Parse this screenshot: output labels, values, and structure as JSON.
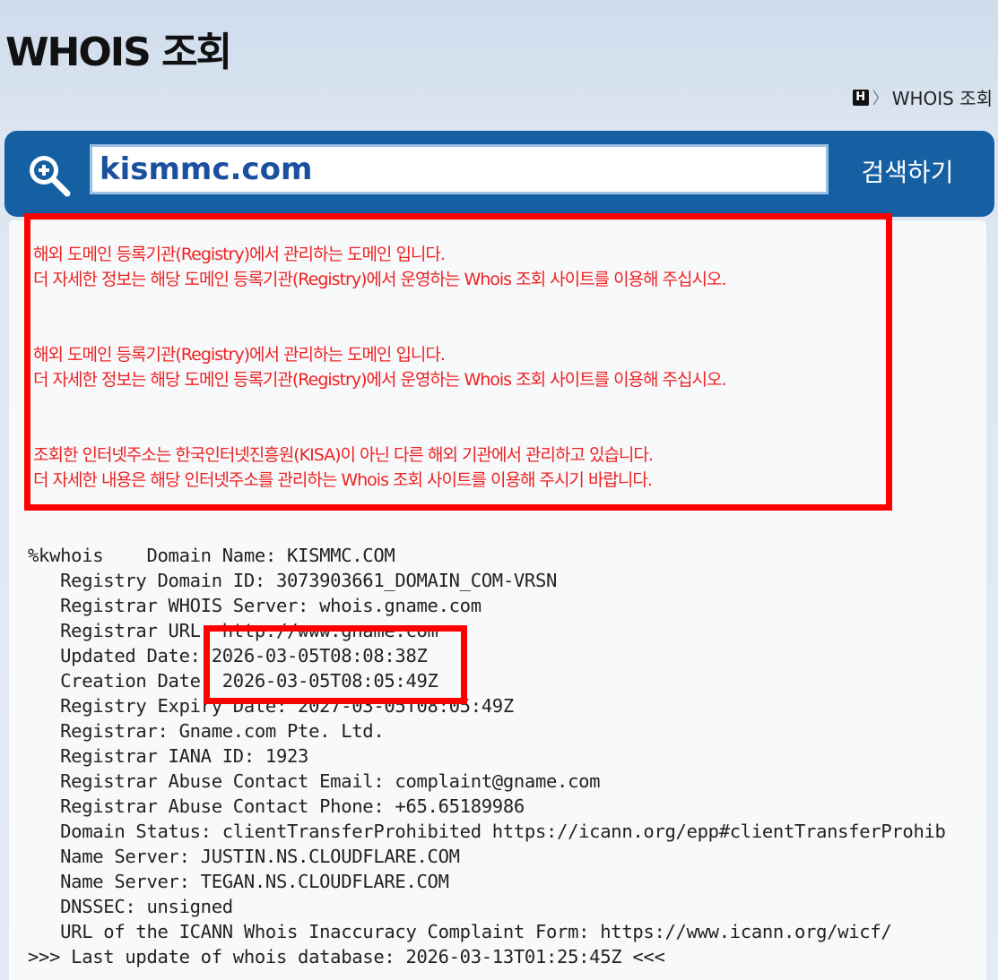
{
  "page": {
    "title": "WHOIS 조회",
    "breadcrumb": {
      "home_icon_text": "H",
      "separator": "〉",
      "current": "WHOIS 조회"
    }
  },
  "search": {
    "query": "kismmc.com",
    "button_label": "검색하기",
    "accent_color": "#155fa3"
  },
  "notices": [
    {
      "line1": "해외 도메인 등록기관(Registry)에서 관리하는 도메인 입니다.",
      "line2": "더 자세한 정보는 해당 도메인 등록기관(Registry)에서 운영하는 Whois 조회 사이트를 이용해 주십시오."
    },
    {
      "line1": "해외 도메인 등록기관(Registry)에서 관리하는 도메인 입니다.",
      "line2": "더 자세한 정보는 해당 도메인 등록기관(Registry)에서 운영하는 Whois 조회 사이트를 이용해 주십시오."
    },
    {
      "line1": "조회한 인터넷주소는 한국인터넷진흥원(KISA)이 아닌 다른 해외 기관에서 관리하고 있습니다.",
      "line2": "더 자세한 내용은 해당 인터넷주소를 관리하는 Whois 조회 사이트를 이용해 주시기 바랍니다."
    }
  ],
  "notice_color": "#ee2222",
  "whois": {
    "lines": [
      "%kwhois    Domain Name: KISMMC.COM",
      "   Registry Domain ID: 3073903661_DOMAIN_COM-VRSN",
      "   Registrar WHOIS Server: whois.gname.com",
      "   Registrar URL: http://www.gname.com",
      "   Updated Date: 2026-03-05T08:08:38Z",
      "   Creation Date: 2026-03-05T08:05:49Z",
      "   Registry Expiry Date: 2027-03-05T08:05:49Z",
      "   Registrar: Gname.com Pte. Ltd.",
      "   Registrar IANA ID: 1923",
      "   Registrar Abuse Contact Email: complaint@gname.com",
      "   Registrar Abuse Contact Phone: +65.65189986",
      "   Domain Status: clientTransferProhibited https://icann.org/epp#clientTransferProhib",
      "   Name Server: JUSTIN.NS.CLOUDFLARE.COM",
      "   Name Server: TEGAN.NS.CLOUDFLARE.COM",
      "   DNSSEC: unsigned",
      "   URL of the ICANN Whois Inaccuracy Complaint Form: https://www.icann.org/wicf/",
      ">>> Last update of whois database: 2026-03-13T01:25:45Z <<<"
    ]
  }
}
